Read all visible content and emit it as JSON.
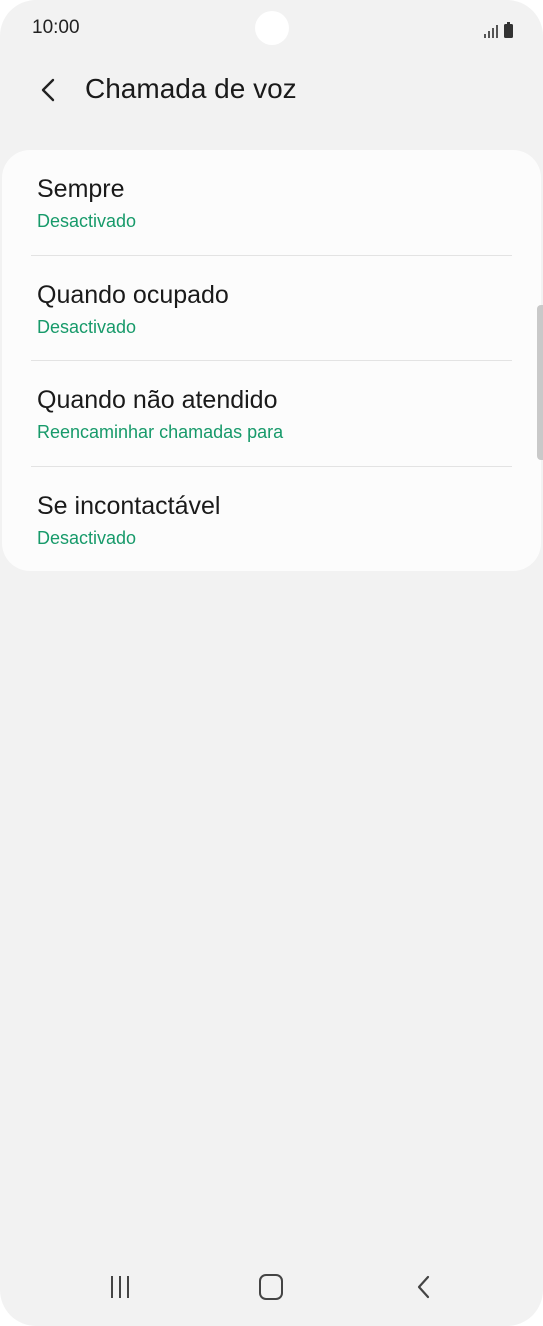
{
  "status_bar": {
    "time": "10:00"
  },
  "header": {
    "title": "Chamada de voz",
    "back_icon": "chevron-left-icon"
  },
  "settings": {
    "items": [
      {
        "title": "Sempre",
        "subtitle": "Desactivado"
      },
      {
        "title": "Quando ocupado",
        "subtitle": "Desactivado"
      },
      {
        "title": "Quando não atendido",
        "subtitle": "Reencaminhar chamadas para"
      },
      {
        "title": "Se incontactável",
        "subtitle": "Desactivado"
      }
    ]
  },
  "nav_bar": {
    "recents_icon": "recents-icon",
    "home_icon": "home-icon",
    "back_icon": "back-icon"
  },
  "colors": {
    "accent": "#179a6a",
    "background": "#f2f2f2",
    "card": "#fcfcfc"
  }
}
